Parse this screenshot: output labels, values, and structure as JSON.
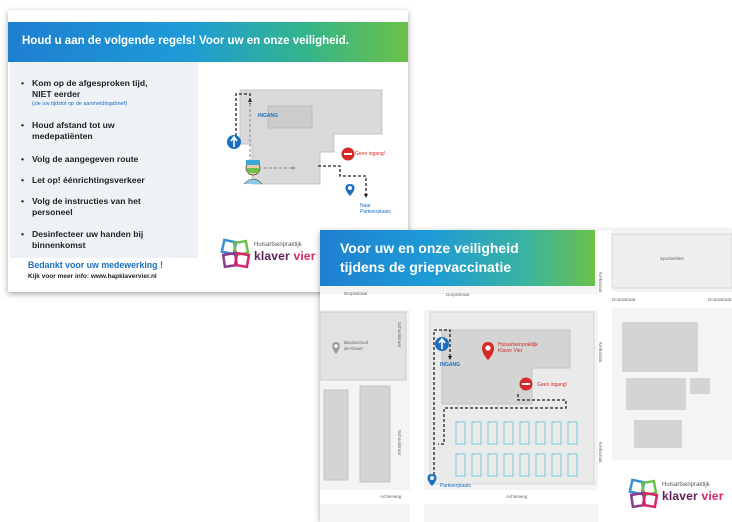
{
  "card1": {
    "title": "Houd u aan de volgende regels!  Voor uw en onze veiligheid.",
    "rules": [
      {
        "text": "Kom op de afgesproken tijd,",
        "text2": "NIET eerder",
        "sub": "(zie uw tijdslot op de aanmeldingsbrief)"
      },
      {
        "text": "Houd afstand tot uw",
        "text2": "medepatiënten"
      },
      {
        "text": "Volg de aangegeven route"
      },
      {
        "text": "Let op! éénrichtingsverkeer"
      },
      {
        "text": "Volg de instructies van het",
        "text2": "personeel"
      },
      {
        "text": "Desinfecteer uw handen bij",
        "text2": "binnenkomst"
      }
    ],
    "thanks": "Bedankt voor uw medewerking !",
    "info": "Kijk voor meer info:  www.hapklavervier.nl",
    "map": {
      "entrance": "INGANG",
      "no_entry": "Geen ingang!",
      "parking_line1": "Naar",
      "parking_line2": "Parkeerplaats"
    },
    "logo": {
      "small": "Huisartsenpraktijk",
      "name_a": "klaver",
      "name_b": "vier"
    }
  },
  "card2": {
    "title_line1": "Voor uw en onze veiligheid",
    "title_line2": "tijdens de griepvaccinatie",
    "streets": {
      "dorpsstraat_left": "Dorpsstraat",
      "dorpsstraat_mid": "Dorpsstraat",
      "dorpsstraat_right1": "Dorpsstraat",
      "dorpsstraat_right2": "Dorpsstraat",
      "schoolstraat_top": "Schoolstraat",
      "schoolstraat_bottom": "Schoolstraat",
      "kerkstraat_top": "Kerkstraat",
      "kerkstraat_mid": "Kerkstraat",
      "kerkstraat_bottom": "Kerkstraat",
      "achterweg_left": "Achterweg",
      "achterweg_right": "Achterweg"
    },
    "places": {
      "basisschool_line1": "Basisschool",
      "basisschool_line2": "de Klaver",
      "sportvelden": "Sportvelden",
      "practice_line1": "Huisartsenpraktijk",
      "practice_line2": "Klaver Vier"
    },
    "map": {
      "entrance": "INGANG",
      "no_entry": "Geen ingang!",
      "parking": "Parkeerplaats"
    },
    "logo": {
      "small": "Huisartsenpraktijk",
      "name_a": "klaver",
      "name_b": "vier"
    }
  },
  "colors": {
    "blue": "#1a6fc0",
    "green": "#6cc04a",
    "red": "#d42a2a",
    "plum": "#5a1f55",
    "pink": "#d6246e"
  },
  "icons": [
    "arrow-up-icon",
    "no-entry-icon",
    "location-pin-icon",
    "nurse-icon",
    "clover-logo-icon"
  ]
}
